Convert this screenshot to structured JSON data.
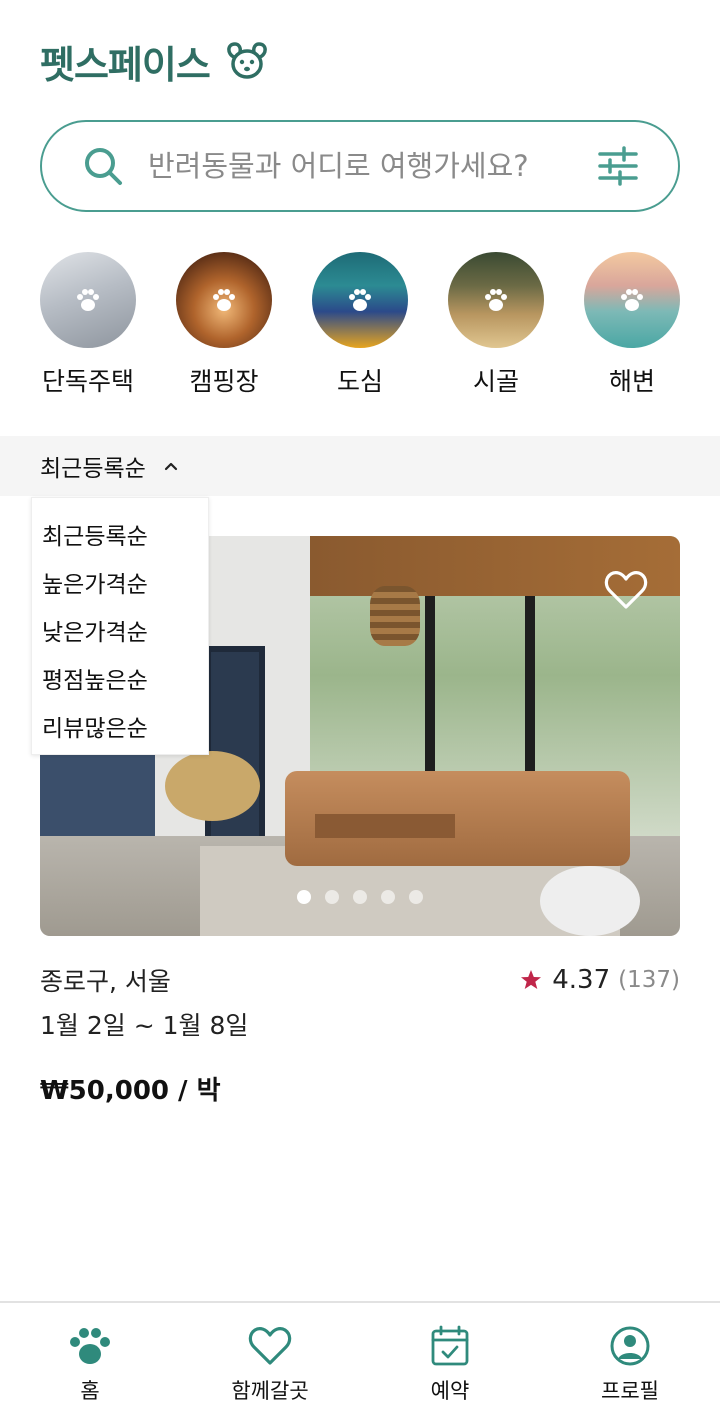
{
  "app": {
    "title": "펫스페이스",
    "logo_icon": "dog-face-icon",
    "brand_color": "#2f6e63",
    "accent_color": "#4a9d90"
  },
  "search": {
    "placeholder": "반려동물과 어디로 여행가세요?",
    "value": "",
    "icon": "search-icon",
    "filter_icon": "sliders-icon"
  },
  "categories": [
    {
      "label": "단독주택",
      "icon": "paw-icon"
    },
    {
      "label": "캠핑장",
      "icon": "paw-icon"
    },
    {
      "label": "도심",
      "icon": "paw-icon"
    },
    {
      "label": "시골",
      "icon": "paw-icon"
    },
    {
      "label": "해변",
      "icon": "paw-icon"
    }
  ],
  "sort": {
    "selected": "최근등록순",
    "expanded": true,
    "options": [
      "최근등록순",
      "높은가격순",
      "낮은가격순",
      "평점높은순",
      "리뷰많은순"
    ]
  },
  "listing": {
    "location": "종로구, 서울",
    "dates": "1월 2일 ~ 1월 8일",
    "price": "₩50,000 / 박",
    "rating": "4.37",
    "review_count": "(137)",
    "star_color": "#c0264a",
    "favorite": false,
    "image_count": 5,
    "active_image": 1
  },
  "nav": [
    {
      "label": "홈",
      "icon": "paw-icon",
      "active": true
    },
    {
      "label": "함께갈곳",
      "icon": "heart-icon",
      "active": false
    },
    {
      "label": "예약",
      "icon": "calendar-icon",
      "active": false
    },
    {
      "label": "프로필",
      "icon": "profile-icon",
      "active": false
    }
  ]
}
